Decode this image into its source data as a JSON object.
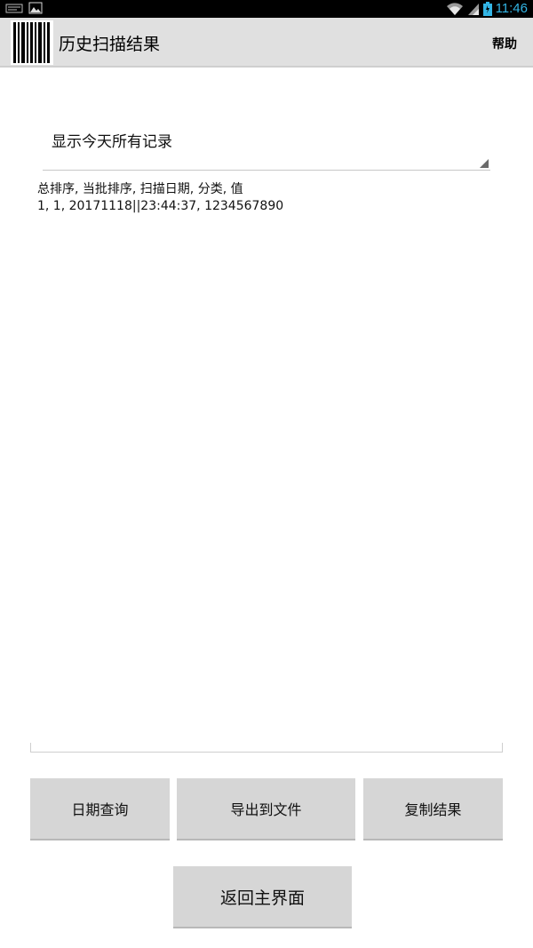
{
  "status_bar": {
    "time": "11:46",
    "icons": [
      "notification-icon",
      "image-icon",
      "wifi-icon",
      "signal-icon",
      "battery-icon"
    ]
  },
  "action_bar": {
    "title": "历史扫描结果",
    "help_label": "帮助",
    "logo_icon": "barcode-icon"
  },
  "filter": {
    "selected": "显示今天所有记录"
  },
  "results": {
    "header": "总排序, 当批排序, 扫描日期, 分类, 值",
    "rows": [
      "1, 1, 20171118||23:44:37, 1234567890"
    ]
  },
  "buttons": {
    "date_query": "日期查询",
    "export_file": "导出到文件",
    "copy_results": "复制结果",
    "back_main": "返回主界面"
  },
  "colors": {
    "clock": "#33b5e5",
    "action_bar": "#e0e0e0",
    "button": "#d6d6d6"
  }
}
